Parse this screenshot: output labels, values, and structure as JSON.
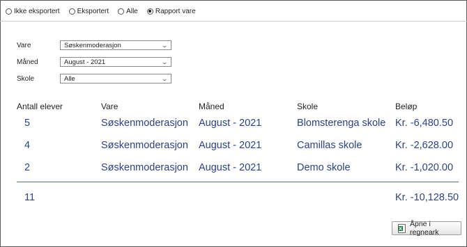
{
  "filter_mode": {
    "options": [
      {
        "label": "Ikke eksportert",
        "checked": false
      },
      {
        "label": "Eksportert",
        "checked": false
      },
      {
        "label": "Alle",
        "checked": false
      },
      {
        "label": "Rapport vare",
        "checked": true
      }
    ]
  },
  "filters": {
    "vare": {
      "label": "Vare",
      "value": "Søskenmoderasjon"
    },
    "maned": {
      "label": "Måned",
      "value": "August - 2021"
    },
    "skole": {
      "label": "Skole",
      "value": "Alle"
    }
  },
  "table": {
    "headers": [
      "Antall elever",
      "Vare",
      "Måned",
      "Skole",
      "Beløp"
    ],
    "rows": [
      [
        "5",
        "Søskenmoderasjon",
        "August - 2021",
        "Blomsterenga skole",
        "Kr. -6,480.50"
      ],
      [
        "4",
        "Søskenmoderasjon",
        "August - 2021",
        "Camillas skole",
        "Kr. -2,628.00"
      ],
      [
        "2",
        "Søskenmoderasjon",
        "August - 2021",
        "Demo skole",
        "Kr. -1,020.00"
      ]
    ],
    "total_count": "11",
    "total_amount": "Kr. -10,128.50"
  },
  "actions": {
    "open_spreadsheet_label": "Åpne i regneark"
  },
  "icons": {
    "select_chevron": "chevron-down-icon",
    "spreadsheet": "excel-icon"
  },
  "colors": {
    "data_text": "#2e3f86",
    "excel_green": "#1e7a3c"
  }
}
